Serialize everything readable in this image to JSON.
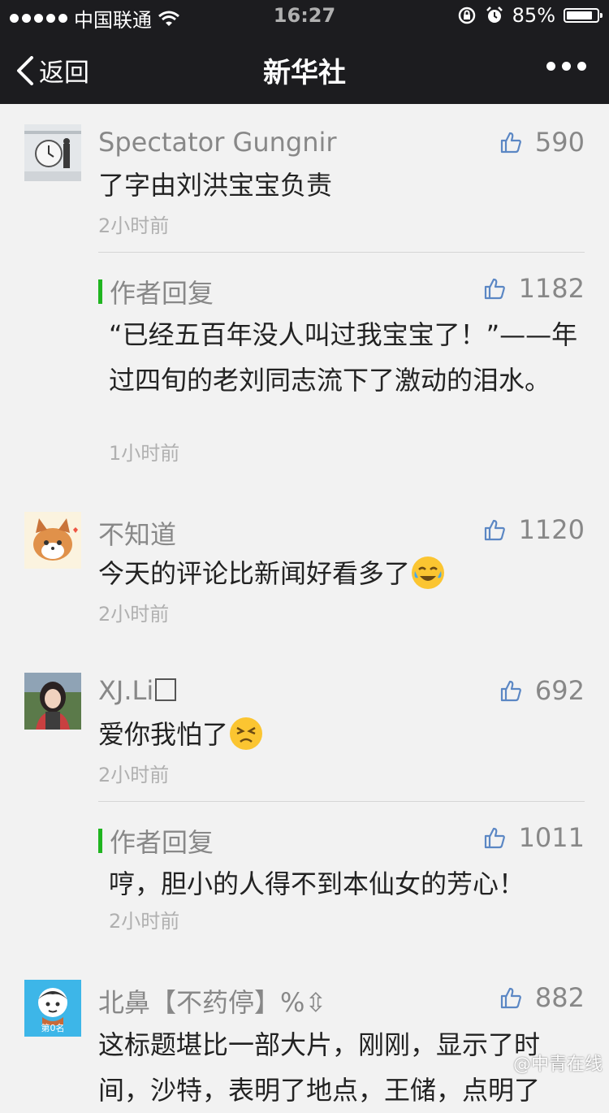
{
  "status_bar": {
    "carrier": "中国联通",
    "time": "16:27",
    "battery": "85%",
    "battery_level": 0.85
  },
  "nav": {
    "back_label": "返回",
    "title": "新华社"
  },
  "comments": [
    {
      "name": "Spectator Gungnir",
      "likes": "590",
      "text": "了字由刘洪宝宝负责",
      "time": "2小时前",
      "reply": {
        "label": "作者回复",
        "likes": "1182",
        "text": "“已经五百年没人叫过我宝宝了！”——年过四旬的老刘同志流下了激动的泪水。",
        "time": "1小时前"
      }
    },
    {
      "name": "不知道",
      "likes": "1120",
      "text": "今天的评论比新闻好看多了",
      "emoji": "cry-laugh-emoji",
      "time": "2小时前"
    },
    {
      "name": "XJ.Li",
      "likes": "692",
      "text": "爱你我怕了",
      "emoji": "persevere-emoji",
      "time": "2小时前",
      "reply": {
        "label": "作者回复",
        "likes": "1011",
        "text": "哼，胆小的人得不到本仙女的芳心！",
        "time": "2小时前"
      }
    },
    {
      "name": "北鼻【不药停】%⇳",
      "likes": "882",
      "text": "这标题堪比一部大片，刚刚，显示了时间，沙特，表明了地点，王储，点明了",
      "avatar_badge": "第0名"
    }
  ],
  "watermark": "@中青在线"
}
